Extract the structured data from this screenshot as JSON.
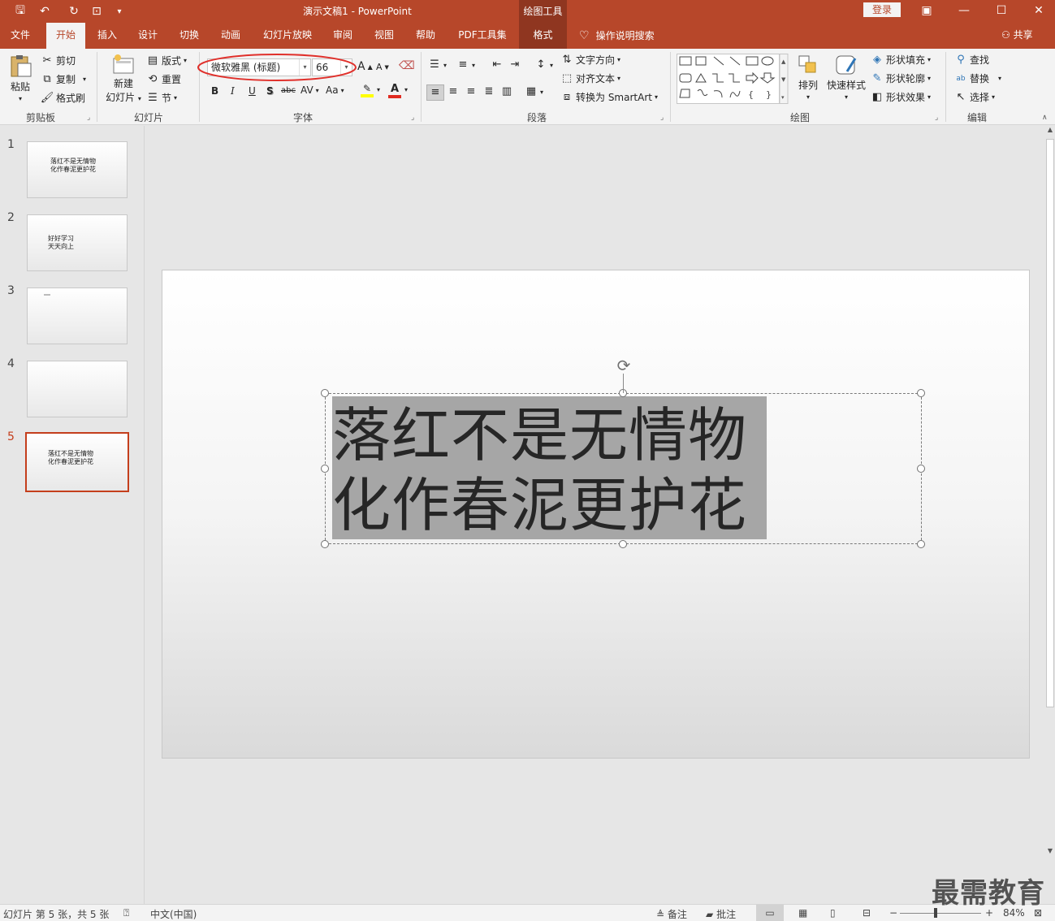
{
  "titlebar": {
    "title": "演示文稿1  -  PowerPoint",
    "context_tab": "绘图工具",
    "login": "登录",
    "qat": {
      "save": "🖫",
      "undo": "↶",
      "redo": "↻",
      "present": "⊡",
      "more": "▾"
    },
    "win": {
      "ribbon_opts": "▣",
      "minimize": "—",
      "maximize": "☐",
      "close": "✕"
    }
  },
  "tabs": [
    "文件",
    "开始",
    "插入",
    "设计",
    "切换",
    "动画",
    "幻灯片放映",
    "审阅",
    "视图",
    "帮助",
    "PDF工具集",
    "格式"
  ],
  "active_tab": "开始",
  "tellme": "操作说明搜索",
  "share": "共享",
  "ribbon": {
    "clipboard": {
      "paste": "粘贴",
      "cut": "剪切",
      "copy": "复制",
      "format_painter": "格式刷",
      "label": "剪贴板"
    },
    "slides": {
      "new_slide_1": "新建",
      "new_slide_2": "幻灯片",
      "layout": "版式",
      "reset": "重置",
      "section": "节",
      "label": "幻灯片"
    },
    "font": {
      "font_name": "微软雅黑 (标题)",
      "font_size": "66",
      "bold": "B",
      "italic": "I",
      "underline": "U",
      "shadow": "S",
      "strike": "abc",
      "spacing": "AV",
      "case": "Aa",
      "grow": "A",
      "shrink": "A",
      "label": "字体"
    },
    "paragraph": {
      "text_direction": "文字方向",
      "align_text": "对齐文本",
      "smartart": "转换为 SmartArt",
      "label": "段落"
    },
    "drawing": {
      "arrange": "排列",
      "quick_styles": "快速样式",
      "shape_fill": "形状填充",
      "shape_outline": "形状轮廓",
      "shape_effects": "形状效果",
      "label": "绘图"
    },
    "editing": {
      "find": "查找",
      "replace": "替换",
      "select": "选择",
      "label": "编辑"
    }
  },
  "thumbnails": [
    {
      "num": "1",
      "line1": "落红不是无情物",
      "line2": "化作春泥更护花"
    },
    {
      "num": "2",
      "line1": "好好学习",
      "line2": "天天向上"
    },
    {
      "num": "3",
      "line1": "",
      "line2": ""
    },
    {
      "num": "4",
      "line1": "",
      "line2": ""
    },
    {
      "num": "5",
      "line1": "落红不是无情物",
      "line2": "化作春泥更护花"
    }
  ],
  "slide": {
    "line1": "落红不是无情物",
    "line2": "化作春泥更护花"
  },
  "statusbar": {
    "slide_info": "幻灯片 第 5 张，共 5 张",
    "language": "中文(中国)",
    "notes": "备注",
    "comments": "批注",
    "zoom": "84%"
  },
  "watermark": "最需教育",
  "colors": {
    "accent": "#b7472a",
    "selected_tab_text": "#b7472a",
    "highlight": "#a6a6a6",
    "annotation_circle": "#e0302b"
  }
}
